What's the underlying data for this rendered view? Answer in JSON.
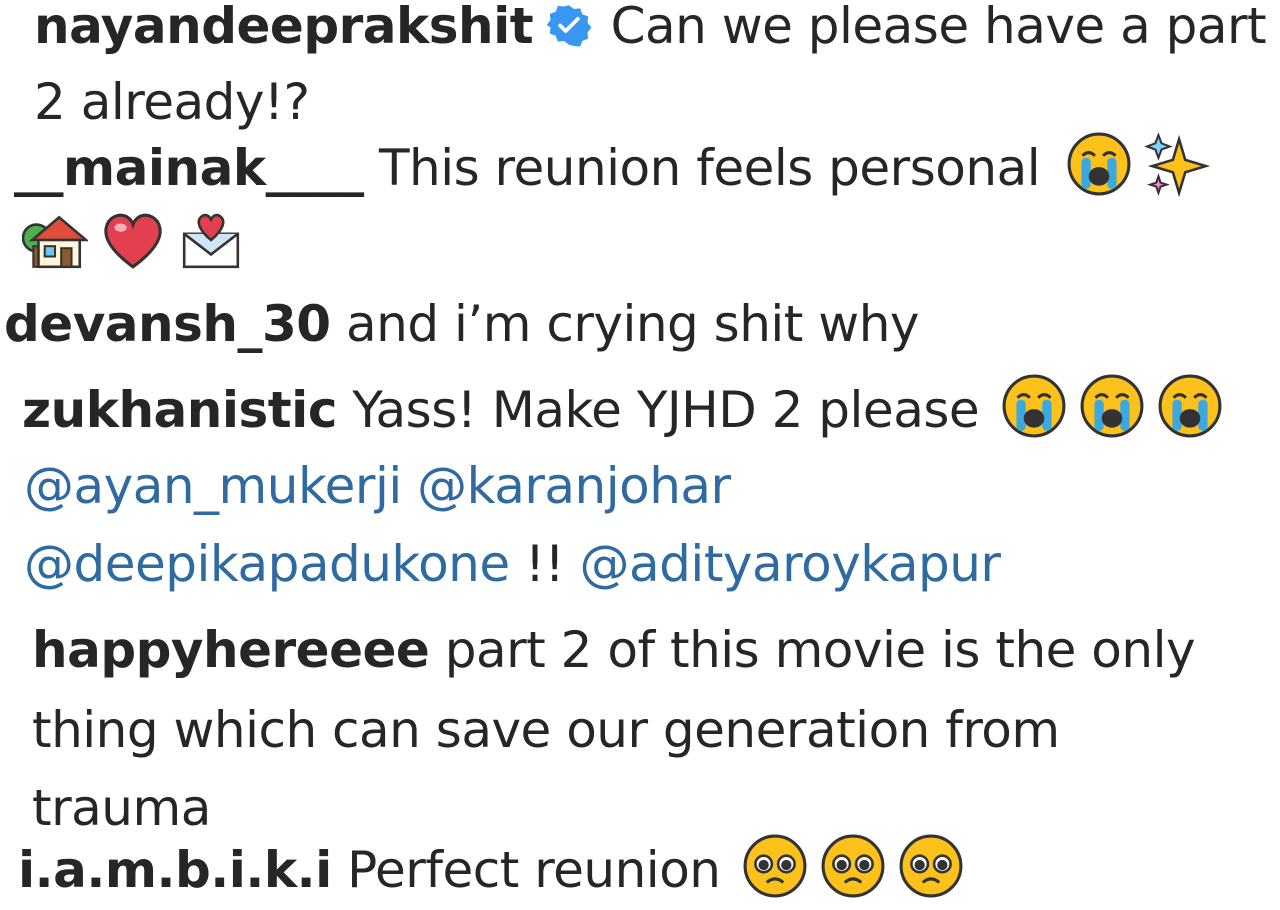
{
  "comments": [
    {
      "username": "nayandeeprakshit",
      "verified": true,
      "text_line1": "Can we please have a part",
      "text_line2": "2 already!?"
    },
    {
      "username": "__mainak____",
      "text": "This reunion feels personal",
      "emojis": [
        "loudly-crying-face",
        "sparkles",
        "house-with-garden",
        "red-heart",
        "love-letter"
      ]
    },
    {
      "username": "devansh_30",
      "text": "and i’m crying shit why"
    },
    {
      "username": "zukhanistic",
      "text": "Yass! Make YJHD 2 please",
      "emojis": [
        "loudly-crying-face",
        "loudly-crying-face",
        "loudly-crying-face"
      ],
      "mentions_line1": [
        "@ayan_mukerji",
        "@karanjohar"
      ],
      "mentions_line2": [
        "@deepikapadukone",
        "!!",
        "@adityaroykapur"
      ]
    },
    {
      "username": "happyhereeee",
      "text_line1": "part 2 of this movie is the only",
      "text_line2": "thing which can save our generation from",
      "text_line3": "trauma"
    },
    {
      "username": "i.a.m.b.i.k.i",
      "text": "Perfect reunion",
      "emojis": [
        "pleading-face",
        "pleading-face",
        "pleading-face"
      ]
    }
  ],
  "colors": {
    "text": "#262626",
    "mention": "#2f6aa0",
    "verified_badge": "#3897f0"
  }
}
